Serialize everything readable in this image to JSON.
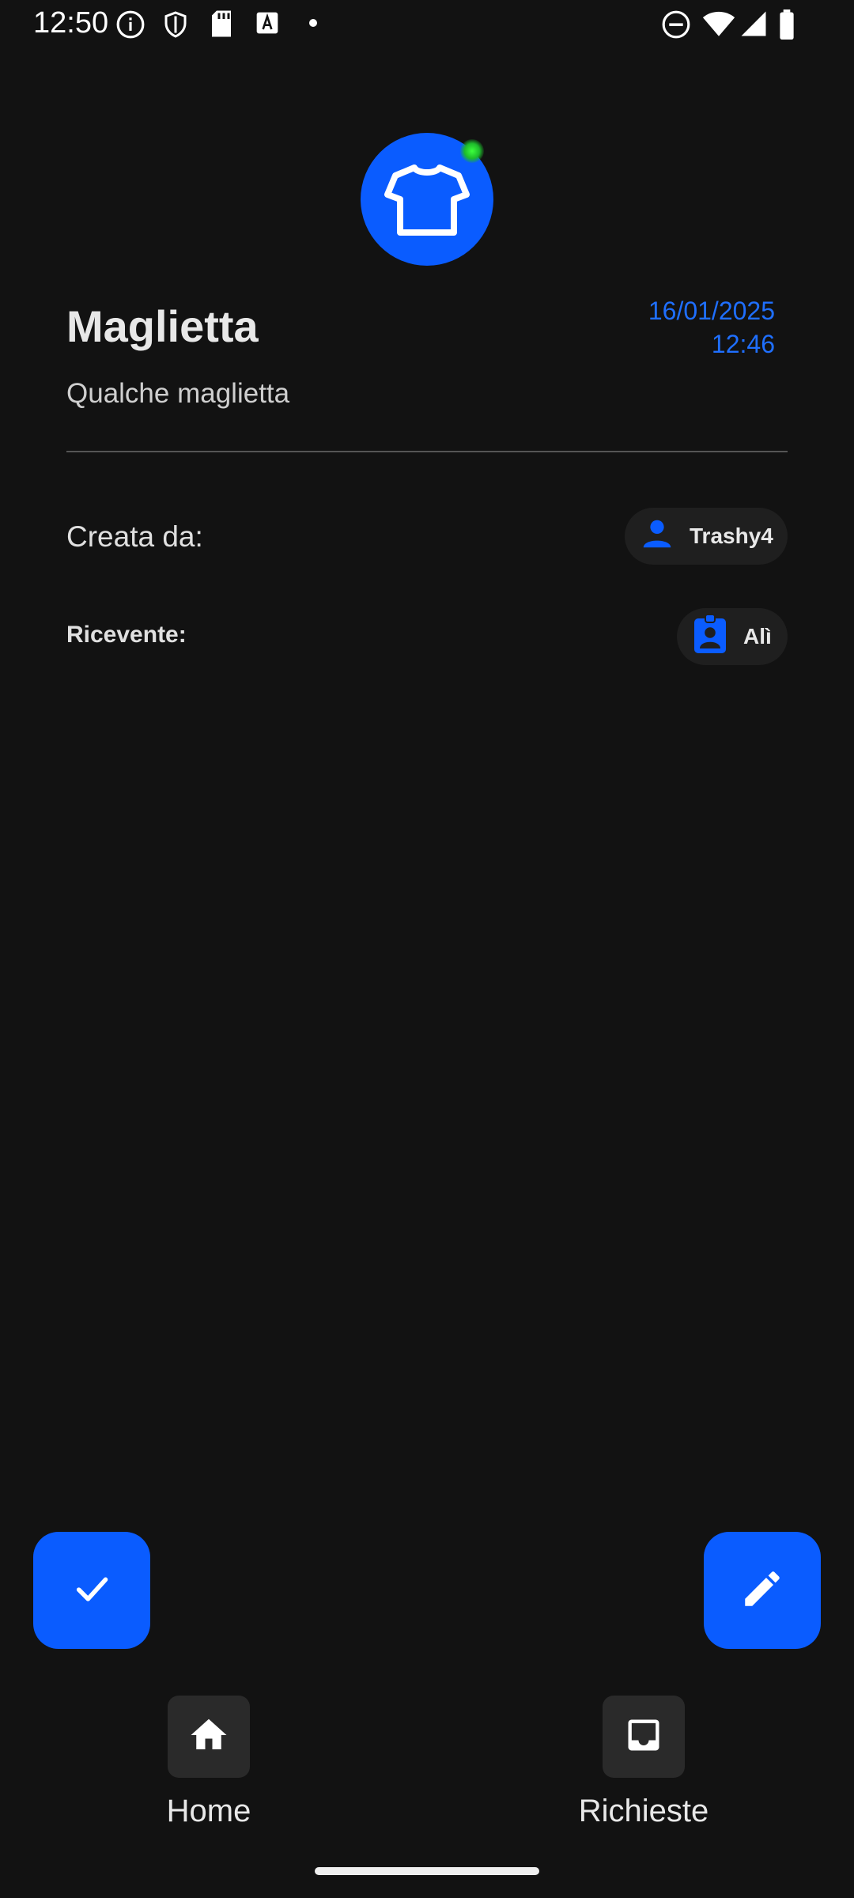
{
  "status_bar": {
    "time": "12:50",
    "icons": [
      "info-icon",
      "shield-icon",
      "sd-card-icon",
      "font-icon",
      "dot-icon",
      "dnd-icon",
      "wifi-icon",
      "signal-icon",
      "battery-icon"
    ]
  },
  "item": {
    "icon": "tshirt-icon",
    "title": "Maglietta",
    "date_line1": "16/01/2025",
    "date_line2": "12:46",
    "description": "Qualche maglietta"
  },
  "creator": {
    "label": "Creata da:",
    "name": "Trashy4",
    "icon": "person-icon"
  },
  "receiver": {
    "label": "Ricevente:",
    "name": "Alì",
    "icon": "badge-icon"
  },
  "fabs": {
    "left_icon": "check-icon",
    "right_icon": "edit-icon"
  },
  "nav": [
    {
      "label": "Home",
      "icon": "home-icon"
    },
    {
      "label": "Richieste",
      "icon": "inbox-icon"
    }
  ],
  "colors": {
    "accent": "#0a5cff",
    "date_color": "#1f6fff",
    "background": "#121212",
    "chip_bg": "#1f1f1f"
  }
}
